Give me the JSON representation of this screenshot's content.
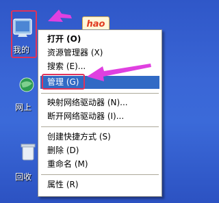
{
  "desktop": {
    "my_computer_label": "我的",
    "network_label": "网上",
    "recycle_label": "回收"
  },
  "hao_badge": "hao",
  "context_menu": {
    "items": [
      {
        "label": "打开 (O)",
        "bold": true
      },
      {
        "label": "资源管理器 (X)"
      },
      {
        "label": "搜索 (E)..."
      },
      {
        "label": "管理 (G)",
        "selected": true
      },
      {
        "label": "映射网络驱动器 (N)..."
      },
      {
        "label": "断开网络驱动器 (I)..."
      },
      {
        "label": "创建快捷方式 (S)"
      },
      {
        "label": "删除 (D)"
      },
      {
        "label": "重命名 (M)"
      },
      {
        "label": "属性 (R)"
      }
    ]
  },
  "colors": {
    "desktop": "#3a66d6",
    "selection": "#316ac5",
    "annotation": "#e0325a",
    "arrow": "#e040e0"
  }
}
